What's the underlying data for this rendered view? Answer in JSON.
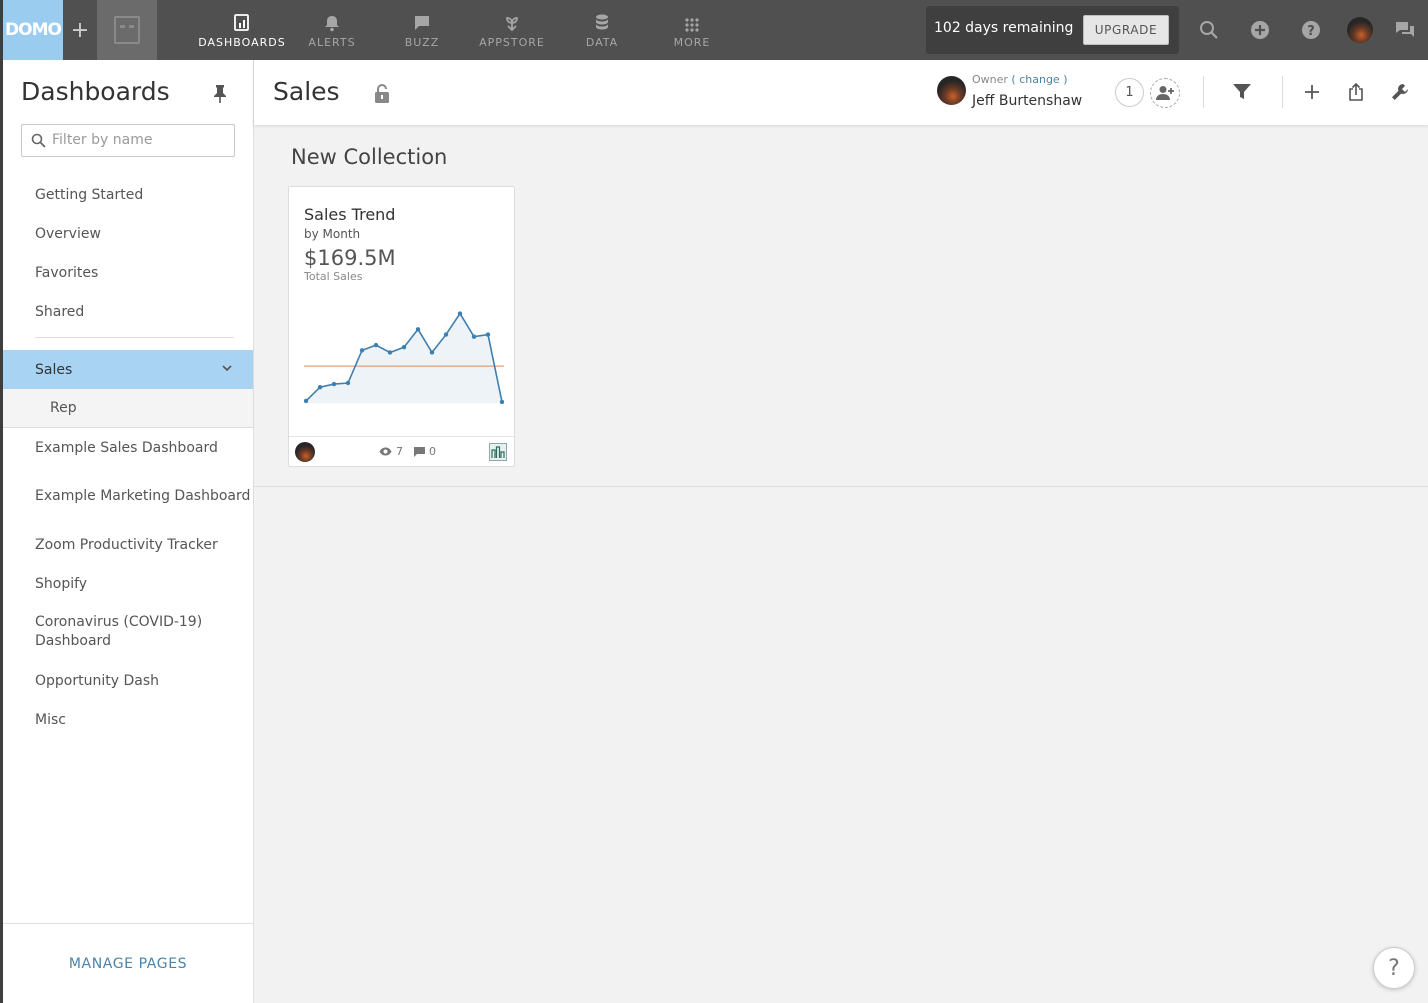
{
  "topbar": {
    "logo": "DOMO",
    "plus": "+",
    "nav": [
      {
        "label": "DASHBOARDS",
        "icon": "dashboards-icon",
        "active": true
      },
      {
        "label": "ALERTS",
        "icon": "bell-icon"
      },
      {
        "label": "BUZZ",
        "icon": "chat-icon"
      },
      {
        "label": "APPSTORE",
        "icon": "appstore-icon"
      },
      {
        "label": "DATA",
        "icon": "database-icon"
      },
      {
        "label": "MORE",
        "icon": "grid-icon"
      }
    ],
    "trial_text": "102 days remaining",
    "upgrade_label": "UPGRADE"
  },
  "sidebar": {
    "title": "Dashboards",
    "filter_placeholder": "Filter by name",
    "items_top": [
      "Getting Started",
      "Overview",
      "Favorites",
      "Shared"
    ],
    "selected": "Sales",
    "sub_item": "Rep",
    "items": [
      "Example Sales Dashboard",
      "Example Marketing Dashboard",
      "Zoom Productivity Tracker",
      "Shopify",
      "Coronavirus (COVID-19) Dashboard",
      "Opportunity Dash",
      "Misc"
    ],
    "manage_label": "MANAGE PAGES"
  },
  "page": {
    "title": "Sales",
    "owner_label": "Owner",
    "owner_change": "( change )",
    "owner_name": "Jeff Burtenshaw",
    "share_count": "1"
  },
  "collection": {
    "title": "New Collection",
    "card": {
      "title": "Sales Trend",
      "subtitle": "by Month",
      "value": "$169.5M",
      "value_label": "Total Sales",
      "views": "7",
      "comments": "0"
    }
  },
  "help_label": "?",
  "colors": {
    "accent": "#99ccee",
    "selected": "#a9d3f3",
    "line": "#3f7fb0",
    "avg_line": "#d98c5f",
    "link": "#4a84a8"
  },
  "chart_data": {
    "type": "area",
    "title": "Sales Trend",
    "x": [
      1,
      2,
      3,
      4,
      5,
      6,
      7,
      8,
      9,
      10,
      11,
      12,
      13,
      14,
      15
    ],
    "values": [
      2,
      15,
      18,
      19,
      50,
      55,
      48,
      53,
      70,
      48,
      65,
      85,
      63,
      65,
      1
    ],
    "average": 35,
    "ylim": [
      0,
      95
    ],
    "grid": false
  }
}
